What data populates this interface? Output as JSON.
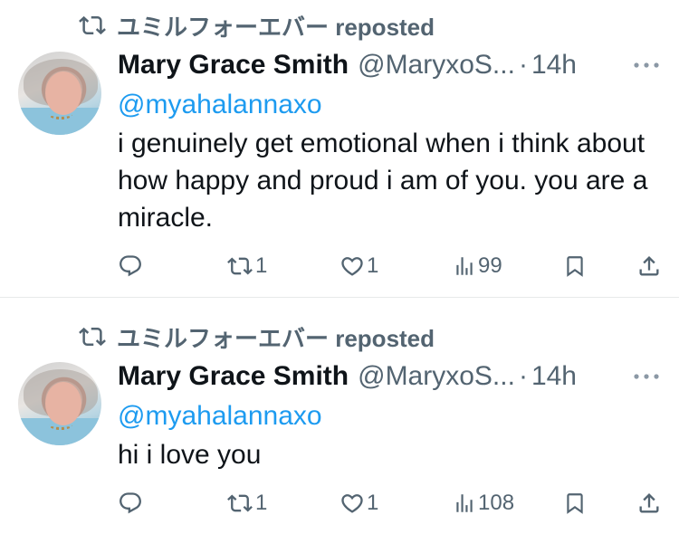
{
  "tweets": [
    {
      "repost_label": "ユミルフォーエバー reposted",
      "author_name": "Mary Grace Smith",
      "handle": "@MaryxoS...",
      "dot": "·",
      "time": "14h",
      "mention": "@myahalannaxo",
      "text": "i genuinely get emotional when i think about how happy and proud i am of you. you are a miracle.",
      "retweets": "1",
      "likes": "1",
      "views": "99"
    },
    {
      "repost_label": "ユミルフォーエバー reposted",
      "author_name": "Mary Grace Smith",
      "handle": "@MaryxoS...",
      "dot": "·",
      "time": "14h",
      "mention": "@myahalannaxo",
      "text": "hi i love you",
      "retweets": "1",
      "likes": "1",
      "views": "108"
    }
  ],
  "icons": {
    "repost": "retweet-icon",
    "more": "more-icon",
    "reply": "reply-icon",
    "retweet": "retweet-icon",
    "like": "heart-icon",
    "views": "views-icon",
    "bookmark": "bookmark-icon",
    "share": "share-icon"
  },
  "colors": {
    "text": "#0f1419",
    "secondary": "#536471",
    "link": "#1d9bf0",
    "divider": "#e7e9ea"
  }
}
